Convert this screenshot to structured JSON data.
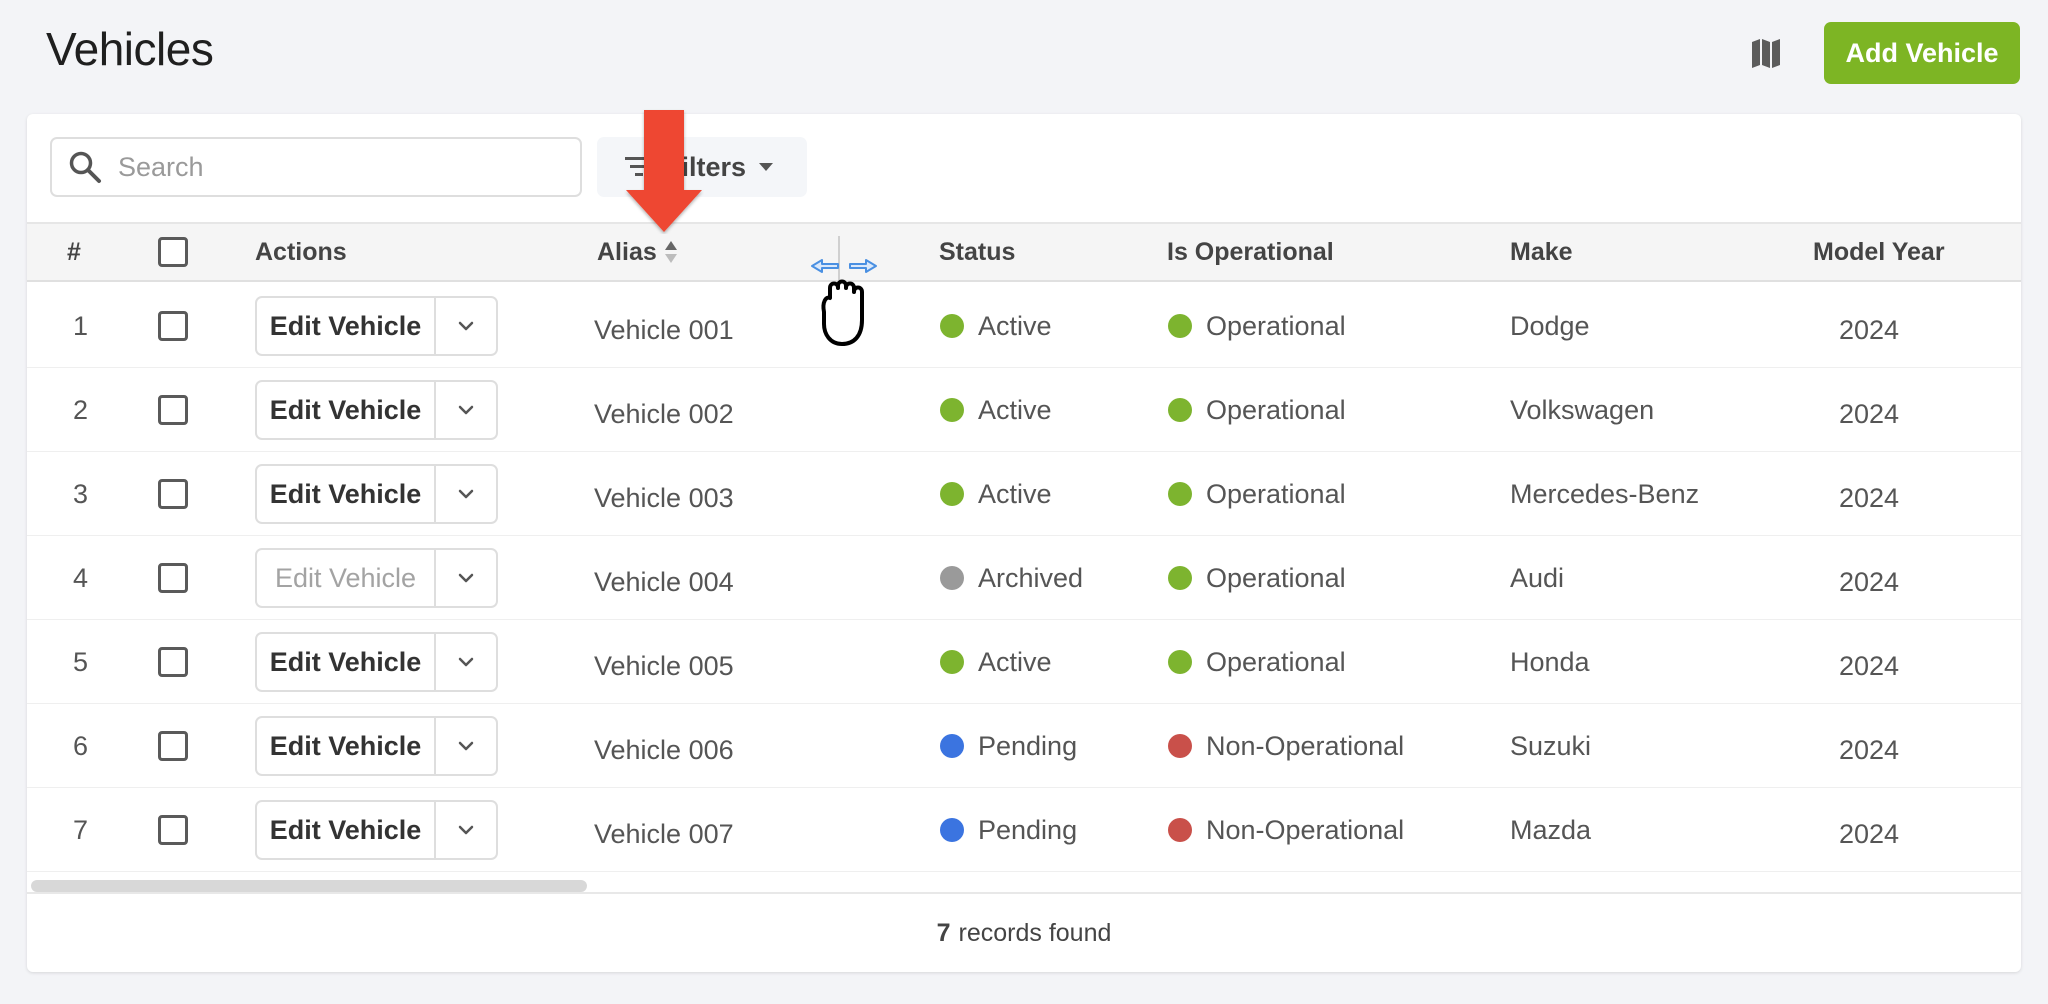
{
  "header": {
    "title": "Vehicles",
    "map_icon": "map-icon",
    "add_button": "Add Vehicle"
  },
  "toolbar": {
    "search_placeholder": "Search",
    "search_value": "",
    "filters_label": "Filters"
  },
  "table": {
    "columns": [
      "#",
      "",
      "Actions",
      "Alias",
      "Status",
      "Is Operational",
      "Make",
      "Model Year"
    ],
    "sorted_column": "Alias",
    "rows": [
      {
        "num": "1",
        "action": "Edit Vehicle",
        "action_disabled": false,
        "alias": "Vehicle 001",
        "status": "Active",
        "status_color": "#7db42f",
        "operational": "Operational",
        "operational_color": "#7db42f",
        "make": "Dodge",
        "year": "2024"
      },
      {
        "num": "2",
        "action": "Edit Vehicle",
        "action_disabled": false,
        "alias": "Vehicle 002",
        "status": "Active",
        "status_color": "#7db42f",
        "operational": "Operational",
        "operational_color": "#7db42f",
        "make": "Volkswagen",
        "year": "2024"
      },
      {
        "num": "3",
        "action": "Edit Vehicle",
        "action_disabled": false,
        "alias": "Vehicle 003",
        "status": "Active",
        "status_color": "#7db42f",
        "operational": "Operational",
        "operational_color": "#7db42f",
        "make": "Mercedes-Benz",
        "year": "2024"
      },
      {
        "num": "4",
        "action": "Edit Vehicle",
        "action_disabled": true,
        "alias": "Vehicle 004",
        "status": "Archived",
        "status_color": "#9a9a9a",
        "operational": "Operational",
        "operational_color": "#7db42f",
        "make": "Audi",
        "year": "2024"
      },
      {
        "num": "5",
        "action": "Edit Vehicle",
        "action_disabled": false,
        "alias": "Vehicle 005",
        "status": "Active",
        "status_color": "#7db42f",
        "operational": "Operational",
        "operational_color": "#7db42f",
        "make": "Honda",
        "year": "2024"
      },
      {
        "num": "6",
        "action": "Edit Vehicle",
        "action_disabled": false,
        "alias": "Vehicle 006",
        "status": "Pending",
        "status_color": "#3b74e0",
        "operational": "Non-Operational",
        "operational_color": "#c9504a",
        "make": "Suzuki",
        "year": "2024"
      },
      {
        "num": "7",
        "action": "Edit Vehicle",
        "action_disabled": false,
        "alias": "Vehicle 007",
        "status": "Pending",
        "status_color": "#3b74e0",
        "operational": "Non-Operational",
        "operational_color": "#c9504a",
        "make": "Mazda",
        "year": "2024"
      }
    ]
  },
  "footer": {
    "count": "7",
    "label": "records found"
  },
  "colors": {
    "accent": "#7db524",
    "annotation_arrow": "#ee4630"
  }
}
